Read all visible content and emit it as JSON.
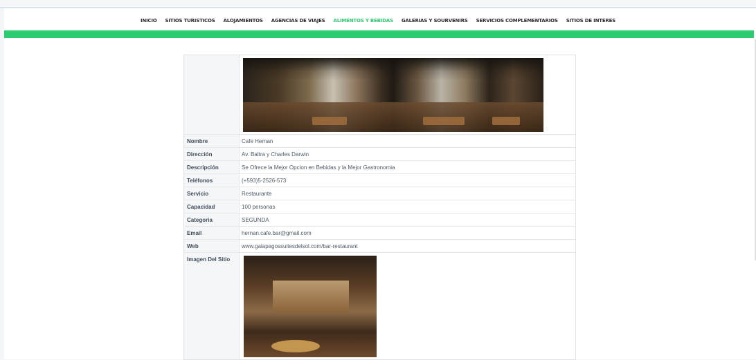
{
  "nav": {
    "items": [
      {
        "label": "INICIO"
      },
      {
        "label": "SITIOS TURISTICOS"
      },
      {
        "label": "ALOJAMIENTOS"
      },
      {
        "label": "AGENCIAS DE VIAJES"
      },
      {
        "label": "ALIMENTOS Y BEBIDAS",
        "active": true
      },
      {
        "label": "GALERIAS Y SOURVENIRS"
      },
      {
        "label": "SERVICIOS COMPLEMENTARIOS"
      },
      {
        "label": "SITIOS DE INTERES"
      }
    ]
  },
  "colors": {
    "accent_green": "#2ecc71",
    "active_nav": "#2ecc71"
  },
  "details": {
    "rows": [
      {
        "label": "Nombre",
        "value": "Cafe Hernan"
      },
      {
        "label": "Dirección",
        "value": "Av. Baltra y Charles Darwin"
      },
      {
        "label": "Descripción",
        "value": "Se Ofrece la Mejor Opcion en Bebidas y la Mejor Gastronomia"
      },
      {
        "label": "Teléfonos",
        "value": "(+593)5-2526-573"
      },
      {
        "label": "Servicio",
        "value": "Restaurante"
      },
      {
        "label": "Capacidad",
        "value": "100 personas"
      },
      {
        "label": "Categoria",
        "value": "SEGUNDA"
      },
      {
        "label": "Email",
        "value": "hernan.cafe.bar@gmail.com"
      },
      {
        "label": "Web",
        "value": "www.galapagossuitesdelsol.com/bar-restaurant"
      }
    ],
    "image_label": "Imagen Del Sitio"
  }
}
